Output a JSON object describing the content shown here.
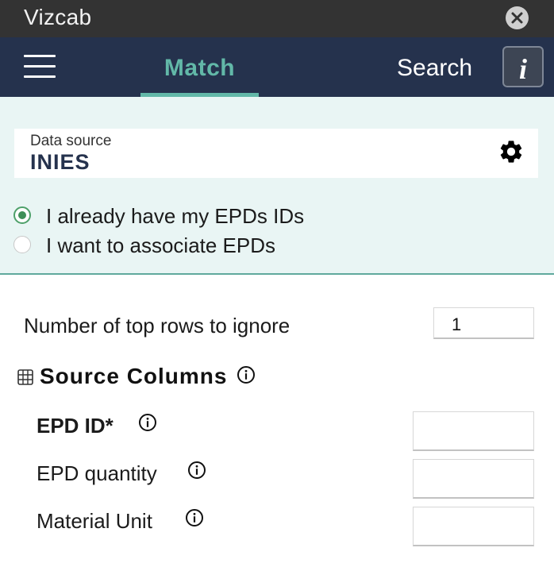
{
  "window": {
    "title": "Vizcab"
  },
  "nav": {
    "active_tab": "Match",
    "search_tab": "Search",
    "info_glyph": "i"
  },
  "data_source": {
    "label": "Data source",
    "value": "INIES"
  },
  "options": [
    {
      "label": "I already have my EPDs IDs",
      "selected": true
    },
    {
      "label": "I want to associate EPDs",
      "selected": false
    }
  ],
  "form": {
    "rows_to_ignore": {
      "label": "Number of top rows to ignore",
      "value": "1"
    },
    "section_title": "Source Columns",
    "fields": [
      {
        "label": "EPD ID*",
        "value": ""
      },
      {
        "label": "EPD quantity",
        "value": ""
      },
      {
        "label": "Material Unit",
        "value": ""
      }
    ]
  },
  "colors": {
    "title_bar": "#333333",
    "nav_bar": "#25324d",
    "accent": "#62b8a8",
    "panel_bg": "#e9f5f4",
    "radio_selected": "#3e8f57"
  },
  "icons": {
    "close": "close-icon",
    "menu": "hamburger-menu-icon",
    "info": "info-icon",
    "settings": "gear-icon",
    "table": "table-icon"
  }
}
